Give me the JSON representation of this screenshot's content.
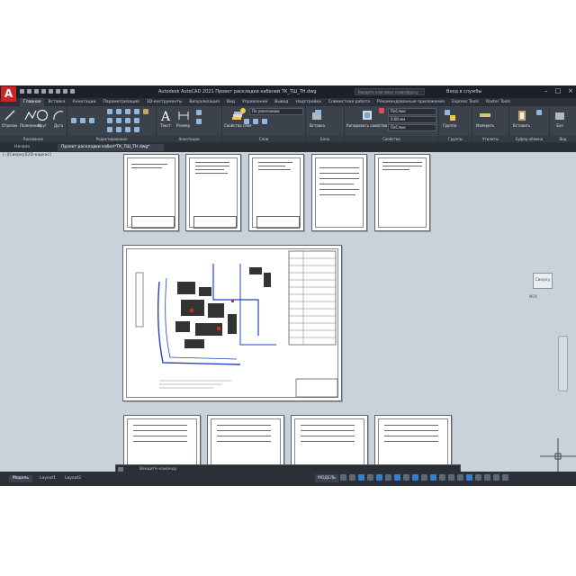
{
  "app": {
    "logo_letter": "A",
    "window_title": "Autodesk AutoCAD 2021   Проект раскладки кабелей ТК_ТШ_ТН.dwg",
    "search_placeholder": "Введите ключевое слово/фразу",
    "user_label": "Вход в службы",
    "window_controls": [
      "–",
      "□",
      "×"
    ]
  },
  "ribbon": {
    "tabs": [
      "Главная",
      "Вставка",
      "Аннотации",
      "Параметризация",
      "3D-инструменты",
      "Визуализация",
      "Вид",
      "Управление",
      "Вывод",
      "Надстройки",
      "Совместная работа",
      "Рекомендованные приложения",
      "Express Tools",
      "Raster Tools"
    ],
    "active_tab": "Главная",
    "tools": {
      "line": "Отрезок",
      "polyline": "Полилиния",
      "circle": "Круг",
      "arc": "Дуга",
      "text": "Текст",
      "dimension": "Размер",
      "layer_props": "Свойства слоя",
      "insert": "Вставка",
      "match_props": "Копировать свойства",
      "group": "Группа",
      "measure": "Измерить",
      "paste": "Вставить",
      "base": "Баз"
    },
    "combos": {
      "layer_current": "По умолчанию",
      "color": "ПоСлою",
      "lineweight": "0.00 мм",
      "linetype": "ПоСлою"
    },
    "panel_labels": [
      "Рисование",
      "Редактирование",
      "Аннотации",
      "Слои",
      "Блок",
      "Свойства",
      "Группы",
      "Утилиты",
      "Буфер обмена",
      "Вид"
    ]
  },
  "file_tabs": [
    "Начало",
    "Проект раскладки кабел*ТК_ТШ_ТН.dwg*"
  ],
  "canvas": {
    "viewport_label": "[–][Сверху][2D-каркас]",
    "viewcube_face": "Сверху",
    "wcs_label": "МСК",
    "ucs_x": "X",
    "ucs_y": "Y"
  },
  "command": {
    "placeholder": "Введите команду"
  },
  "status": {
    "layout_tabs": [
      "Модель",
      "Layout1",
      "Layout2"
    ],
    "active_layout": "Модель",
    "model_label": "МОДЕЛЬ"
  },
  "colors": {
    "background": "#21252b",
    "canvas": "#c9d2db",
    "accent_blue": "#2f7fd1",
    "logo_red": "#c62828"
  }
}
